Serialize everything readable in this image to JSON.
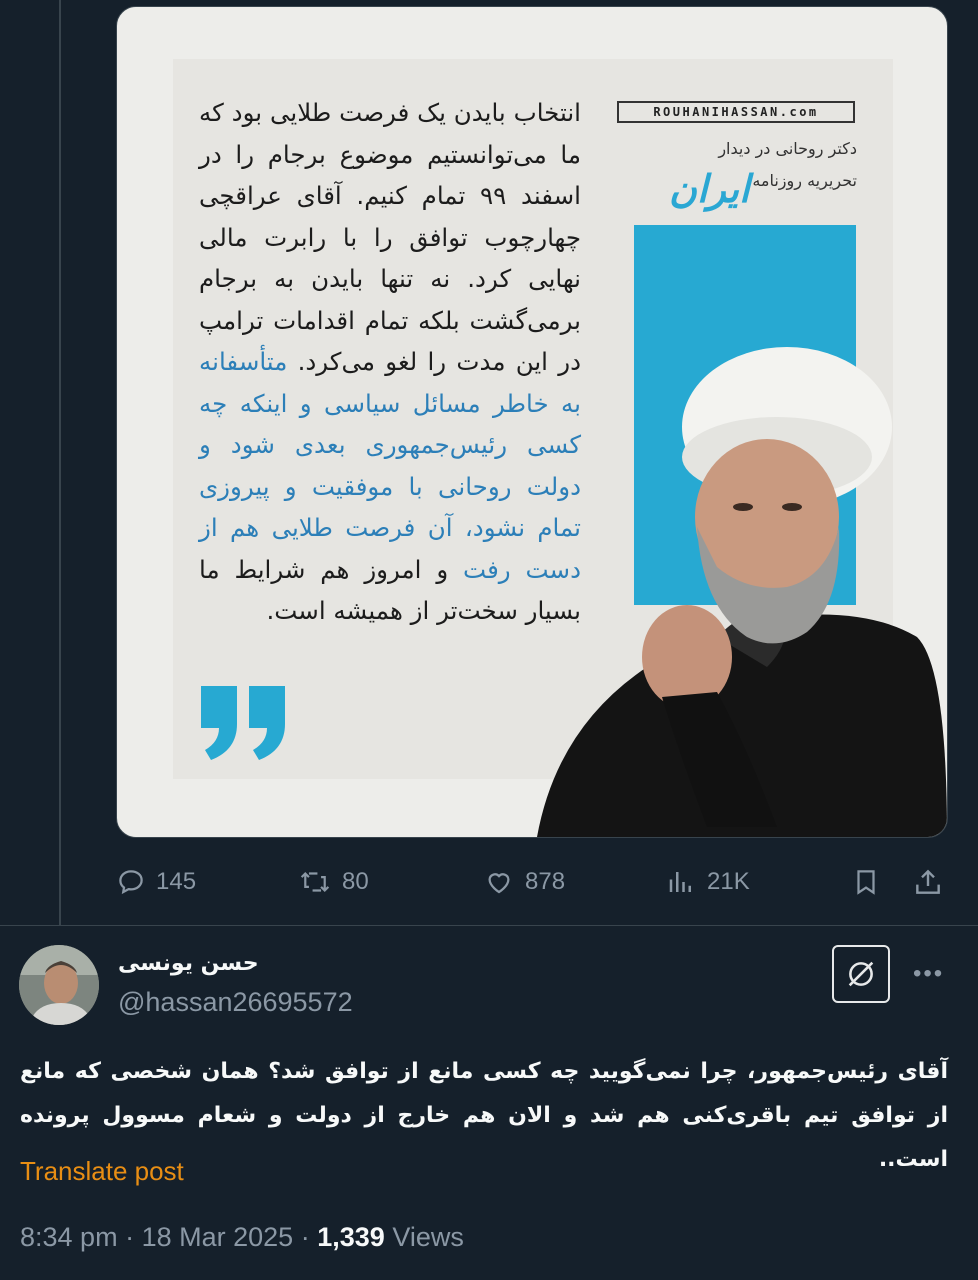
{
  "post": {
    "image": {
      "brand": "ROUHANIHASSAN.com",
      "meeting_line1": "دکتر روحانی در دیدار",
      "meeting_line2": "تحریریه روزنامه",
      "paper_name": "ایران",
      "quote_part1": "انتخاب بایدن یک فرصت طلایی بود که ما می‌توانستیم موضوع برجام را در اسفند ۹۹ تمام کنیم. آقای عراقچی چهارچوب توافق را با رابرت مالی نهایی کرد. نه تنها بایدن به برجام برمی‌گشت بلکه تمام اقدامات ترامپ در این مدت را لغو می‌کرد.",
      "quote_part2": "متأسفانه به خاطر مسائل سیاسی و اینکه چه کسی رئیس‌جمهوری بعدی شود و دولت روحانی با موفقیت و پیروزی تمام نشود، آن فرصت طلایی هم از دست رفت",
      "quote_part3": "و امروز هم شرایط ما بسیار سخت‌تر از همیشه است.",
      "accent_color": "#27a9d2"
    },
    "actions": {
      "replies": "145",
      "reposts": "80",
      "likes": "878",
      "views": "21K"
    }
  },
  "reply": {
    "display_name": "حسن یونسی",
    "handle": "@hassan26695572",
    "text": "آقای رئیس‌جمهور، چرا نمی‌گویید چه کسی مانع از توافق شد؟ همان شخصی که مانع از توافق تیم باقری‌کنی هم شد و الان هم خارج از دولت و شعام مسوول پرونده است..",
    "translate_label": "Translate post",
    "time": "8:34 pm",
    "date": "18 Mar 2025",
    "views_count": "1,339",
    "views_label": "Views",
    "separator": "·"
  },
  "colors": {
    "background": "#15202b",
    "muted": "#8b98a5",
    "translate": "#e88e14",
    "text": "#f7f9f9"
  }
}
